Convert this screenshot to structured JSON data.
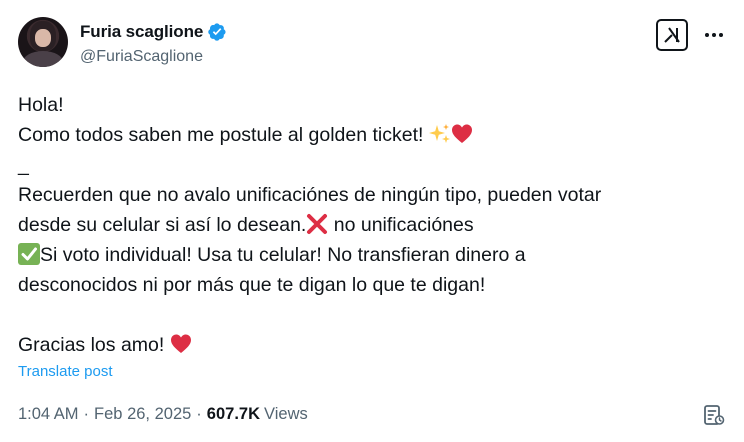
{
  "author": {
    "display_name": "Furia scaglione",
    "handle": "@FuriaScaglione",
    "verified": true,
    "verified_color": "#1d9bf0"
  },
  "post": {
    "line1": "Hola!",
    "line2": "Como todos saben me postule al golden ticket!",
    "line3": "_",
    "line4": "Recuerden que no avalo unificaciónes de ningún tipo, pueden votar",
    "line5_a": "desde su celular si así lo desean.",
    "line5_b": " no unificaciónes",
    "line6": "Si voto individual! Usa tu celular! No transfieran dinero a",
    "line7": "desconocidos ni por más que te digan lo que te digan!",
    "line8": "Gracias los amo!"
  },
  "translate_label": "Translate post",
  "meta": {
    "time": "1:04 AM",
    "separator": "·",
    "date": "Feb 26, 2025",
    "views_count": "607.7K",
    "views_label": "Views"
  },
  "icons": {
    "grok": "grok-icon",
    "more": "more-icon",
    "sparkles": "sparkles-emoji",
    "heart": "red-heart-emoji",
    "cross": "cross-mark-emoji",
    "check": "check-mark-emoji",
    "stats": "post-analytics-icon"
  },
  "colors": {
    "text": "#0f1419",
    "secondary": "#536471",
    "link": "#1d9bf0",
    "heart": "#dd2e44",
    "cross": "#dd2e44",
    "check": "#77b255"
  }
}
